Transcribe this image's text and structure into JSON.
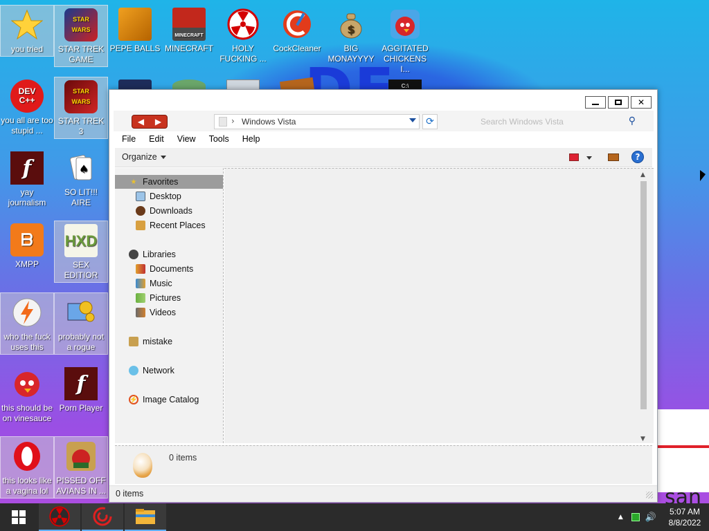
{
  "desktop": {
    "icons": [
      {
        "label": "you tried",
        "icon": "star-icon"
      },
      {
        "label": "STAR TREK GAME",
        "icon": "star-wars-game-icon"
      },
      {
        "label": "PEPE BALLS",
        "icon": "blocks-icon"
      },
      {
        "label": "MINECRAFT",
        "icon": "minecraft-icon"
      },
      {
        "label": "HOLY FUCKING ...",
        "icon": "radiation-icon"
      },
      {
        "label": "CockCleaner",
        "icon": "ccleaner-icon"
      },
      {
        "label": "BIG MONAYYYY",
        "icon": "money-bag-icon"
      },
      {
        "label": "AGGITATED CHICKENS I...",
        "icon": "angry-birds-icon"
      },
      {
        "label": "you all are too stupid ...",
        "icon": "dev-cpp-icon"
      },
      {
        "label": "STAR TREK 3",
        "icon": "star-wars-3-icon"
      },
      {
        "label": "yay journalism",
        "icon": "flash-icon"
      },
      {
        "label": "SO LIT!!! AIRE",
        "icon": "solitaire-icon"
      },
      {
        "label": "XMPP",
        "icon": "xampp-icon"
      },
      {
        "label": "SEX EDITIOR",
        "icon": "hxd-icon"
      },
      {
        "label": "who the fuck uses this",
        "icon": "winamp-icon"
      },
      {
        "label": "probably not a rogue",
        "icon": "settings-pc-icon"
      },
      {
        "label": "this should be on vinesauce",
        "icon": "angry-birds-icon"
      },
      {
        "label": "Porn Player",
        "icon": "flash-player-icon"
      },
      {
        "label": "this looks like a vagina lol",
        "icon": "opera-icon"
      },
      {
        "label": "PISSED OFF AVIANS IN ...",
        "icon": "angry-birds-seasons-icon"
      }
    ],
    "wallpaper_text": "DE",
    "widget_text": "san"
  },
  "explorer": {
    "address_path": "Windows Vista",
    "search_placeholder": "Search Windows Vista",
    "menu": [
      "File",
      "Edit",
      "View",
      "Tools",
      "Help"
    ],
    "organize_label": "Organize",
    "nav": {
      "favorites_label": "Favorites",
      "favorites": [
        "Desktop",
        "Downloads",
        "Recent Places"
      ],
      "libraries_label": "Libraries",
      "libraries": [
        "Documents",
        "Music",
        "Pictures",
        "Videos"
      ],
      "homegroup_label": "mistake",
      "network_label": "Network",
      "image_catalog_label": "Image Catalog"
    },
    "details_count": "0 items",
    "status_count": "0 items"
  },
  "taskbar": {
    "time": "5:07 AM",
    "date": "8/8/2022"
  }
}
